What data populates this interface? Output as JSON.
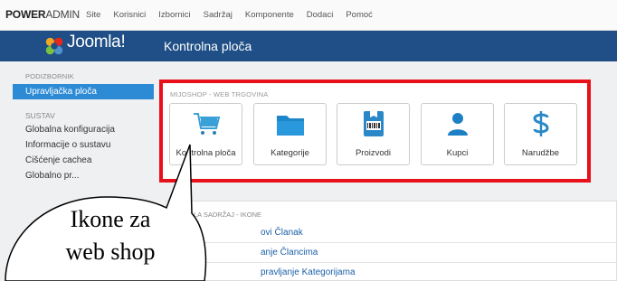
{
  "topbar": {
    "brand_bold": "POWER",
    "brand_light": "ADMIN",
    "menu": [
      "Site",
      "Korisnici",
      "Izbornici",
      "Sadržaj",
      "Komponente",
      "Dodaci",
      "Pomoć"
    ]
  },
  "header": {
    "logo_text": "Joomla!",
    "title": "Kontrolna ploča",
    "bg_color": "#1f4f86"
  },
  "sidebar": {
    "section1": "PODIZBORNIK",
    "active_item": "Upravljačka ploča",
    "section2": "SUSTAV",
    "items": [
      "Globalna konfiguracija",
      "Informacije o sustavu",
      "Čišćenje cachea",
      "Globalno pr..."
    ]
  },
  "shop_panel": {
    "title": "MIJOSHOP - WEB TRGOVINA",
    "highlight_color": "#e8101a",
    "tiles": [
      {
        "label": "Kontrolna ploča",
        "icon": "cart-icon"
      },
      {
        "label": "Kategorije",
        "icon": "folder-icon"
      },
      {
        "label": "Proizvodi",
        "icon": "product-icon"
      },
      {
        "label": "Kupci",
        "icon": "user-icon"
      },
      {
        "label": "Narudžbe",
        "icon": "dollar-icon"
      }
    ]
  },
  "content_panel": {
    "title": "LA SADRŽAJ - IKONE",
    "links": [
      "ovi Članak",
      "anje Člancima",
      "pravljanje Kategorijama"
    ]
  },
  "callout": {
    "line1": "Ikone za",
    "line2": "web shop"
  }
}
